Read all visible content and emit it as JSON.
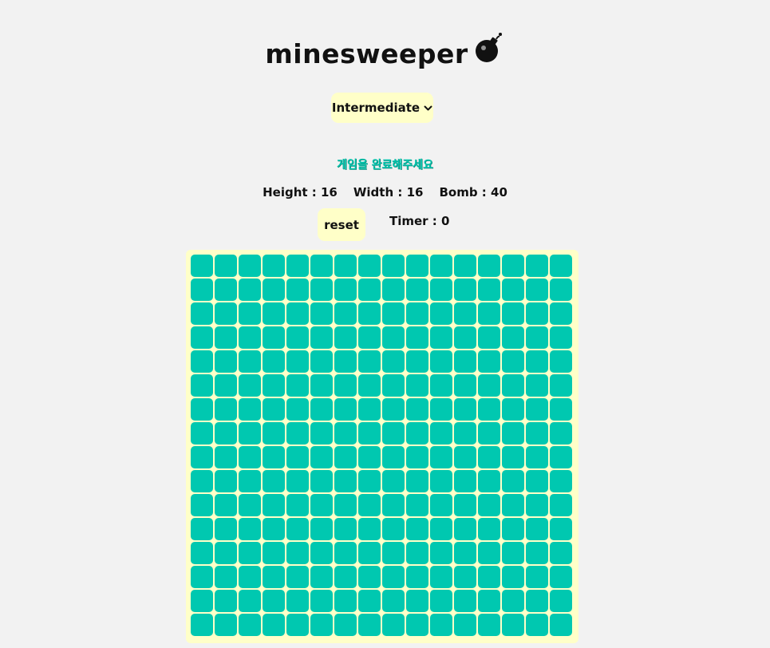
{
  "header": {
    "title": "minesweeper",
    "title_icon": "bomb-icon"
  },
  "difficulty": {
    "selected": "Intermediate",
    "icon": "chevron-down-icon"
  },
  "status": {
    "message": "게임을 완료해주세요"
  },
  "stats": {
    "height_label": "Height : 16",
    "width_label": "Width : 16",
    "bomb_label": "Bomb : 40"
  },
  "controls": {
    "reset_label": "reset",
    "timer_label": "Timer : 0"
  },
  "board": {
    "rows": 16,
    "cols": 16,
    "cell_state": "unrevealed"
  },
  "colors": {
    "background": "#f2f2f2",
    "accent_panel": "#ffffc8",
    "cell": "#00c8b0",
    "status_text": "#00c4ac"
  }
}
